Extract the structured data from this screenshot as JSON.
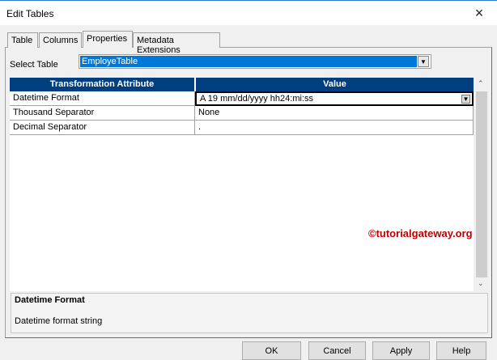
{
  "window": {
    "title": "Edit Tables",
    "close_icon": "×"
  },
  "tabs": [
    {
      "label": "Table"
    },
    {
      "label": "Columns"
    },
    {
      "label": "Properties",
      "active": true
    },
    {
      "label": "Metadata Extensions"
    }
  ],
  "select_table": {
    "label": "Select Table",
    "value": "EmployeTable"
  },
  "grid": {
    "headers": [
      "Transformation Attribute",
      "Value"
    ],
    "rows": [
      {
        "attribute": "Datetime Format",
        "value": "A  19 mm/dd/yyyy hh24:mi:ss"
      },
      {
        "attribute": "Thousand Separator",
        "value": "None"
      },
      {
        "attribute": "Decimal Separator",
        "value": "."
      }
    ]
  },
  "description": {
    "title": "Datetime Format",
    "text": "Datetime format string"
  },
  "buttons": {
    "ok": "OK",
    "cancel": "Cancel",
    "apply": "Apply",
    "help": "Help"
  },
  "watermark": "©tutorialgateway.org"
}
